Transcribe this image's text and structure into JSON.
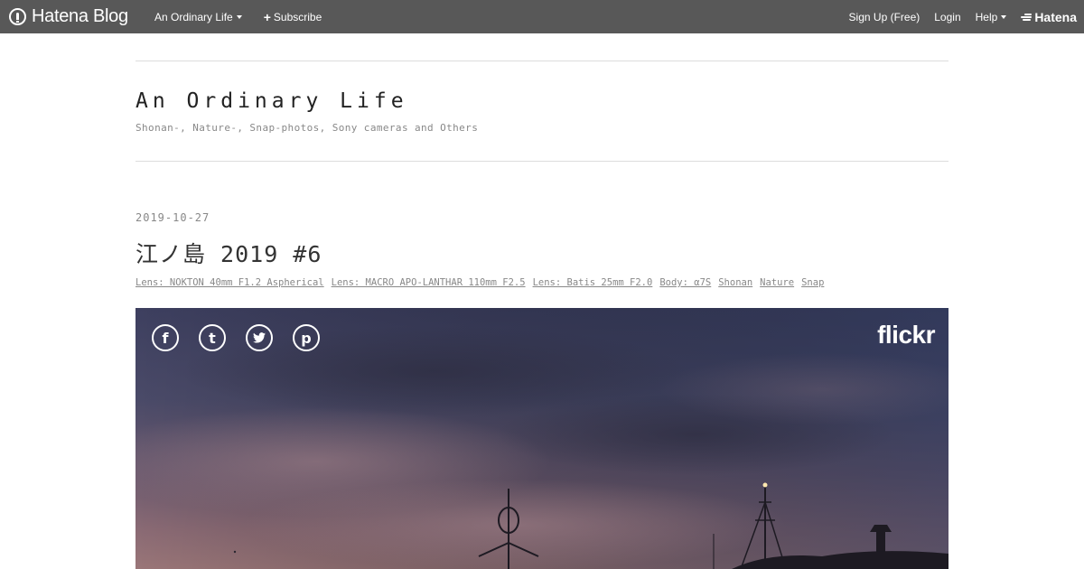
{
  "topbar": {
    "brand": "Hatena Blog",
    "blog_menu": "An Ordinary Life",
    "subscribe": "Subscribe",
    "signup": "Sign Up (Free)",
    "login": "Login",
    "help": "Help",
    "hatena": "Hatena"
  },
  "header": {
    "title": "An Ordinary Life",
    "description": "Shonan-, Nature-, Snap-photos, Sony cameras and Others"
  },
  "entry": {
    "date": "2019-10-27",
    "title": "江ノ島 2019 #6",
    "categories": [
      "Lens: NOKTON 40mm F1.2 Aspherical",
      "Lens: MACRO APO-LANTHAR 110mm F2.5",
      "Lens: Batis 25mm F2.0",
      "Body: α7S",
      "Shonan",
      "Nature",
      "Snap"
    ]
  },
  "photo": {
    "share_icons": [
      "facebook-icon",
      "tumblr-icon",
      "twitter-icon",
      "pinterest-icon"
    ],
    "share_glyphs": [
      "f",
      "t",
      "🐦",
      "p"
    ],
    "provider": "flickr"
  }
}
